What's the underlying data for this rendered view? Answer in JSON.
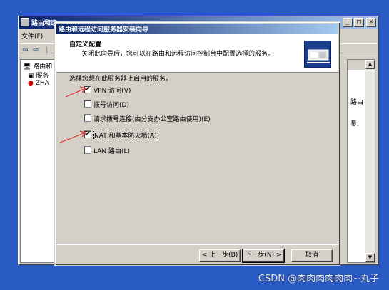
{
  "background_window": {
    "title": "路由和远",
    "menu_file": "文件(F)",
    "tree_root": "路由和",
    "tree_server": "服务",
    "tree_item": "ZHA",
    "right_text_1": "路由",
    "right_text_2": "息,"
  },
  "wizard": {
    "title": "路由和远程访问服务器安装向导",
    "header_title": "自定义配置",
    "header_subtitle": "关闭此向导后，您可以在路由和远程访问控制台中配置选择的服务。",
    "prompt": "选择您想在此服务器上启用的服务。",
    "options": [
      {
        "label": "VPN 访问(V)",
        "checked": true
      },
      {
        "label": "拨号访问(D)",
        "checked": false
      },
      {
        "label": "请求拨号连接(由分支办公室路由使用)(E)",
        "checked": false
      },
      {
        "label": "NAT 和基本防火墙(A)",
        "checked": true
      },
      {
        "label": "LAN 路由(L)",
        "checked": false
      }
    ],
    "buttons": {
      "back": "< 上一步(B)",
      "next": "下一步(N) >",
      "cancel": "取消"
    }
  },
  "watermark": "CSDN @肉肉肉肉肉肉~丸子",
  "colors": {
    "desktop": "#2a5ac4",
    "title_bar": "#0a246a",
    "arrow": "#e03030"
  }
}
